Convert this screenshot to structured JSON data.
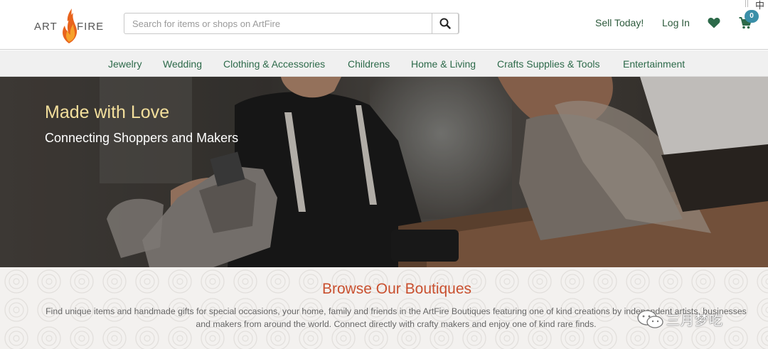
{
  "brand": {
    "logo_left": "ART",
    "logo_right": "FIRE",
    "accent": "#e8631c"
  },
  "search": {
    "placeholder": "Search for items or shops on ArtFire",
    "value": "",
    "icon": "search-icon"
  },
  "account": {
    "sell_label": "Sell Today!",
    "login_label": "Log In",
    "favorites_icon": "heart-icon",
    "cart_icon": "cart-icon",
    "cart_count": "0",
    "corner_glyph": "中"
  },
  "categories": [
    {
      "label": "Jewelry"
    },
    {
      "label": "Wedding"
    },
    {
      "label": "Clothing & Accessories"
    },
    {
      "label": "Childrens"
    },
    {
      "label": "Home & Living"
    },
    {
      "label": "Crafts Supplies & Tools"
    },
    {
      "label": "Entertainment"
    }
  ],
  "hero": {
    "title": "Made with Love",
    "subtitle": "Connecting Shoppers and Makers"
  },
  "boutiques": {
    "title": "Browse Our Boutiques",
    "line1": "Find unique items and handmade gifts for special occasions, your home, family and friends in the ArtFire Boutiques featuring one of kind creations by independent artists, businesses",
    "line2": "and makers from around the world. Connect directly with crafty makers and enjoy one of kind rare finds."
  },
  "watermark": {
    "text": "三月梦吃"
  },
  "colors": {
    "nav_green": "#2d6a4a",
    "header_green": "#2d5a3c",
    "hero_title": "#f3df9c",
    "section_title": "#c9502f",
    "badge": "#3a8fa8"
  }
}
